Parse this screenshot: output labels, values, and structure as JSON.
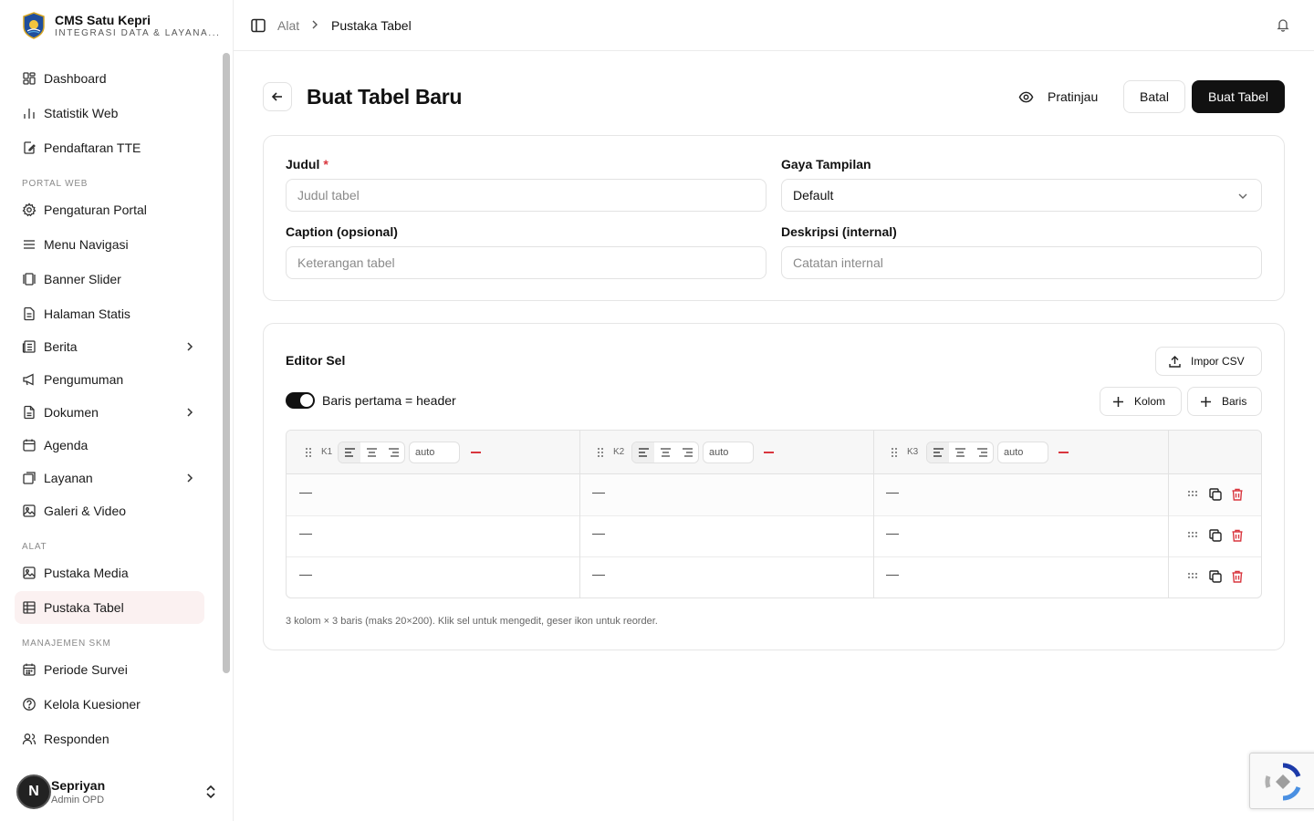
{
  "brand": {
    "title": "CMS Satu Kepri",
    "subtitle": "INTEGRASI DATA & LAYANA..."
  },
  "sidebar": {
    "items_top": [
      {
        "label": "Dashboard",
        "icon": "dashboard-icon"
      },
      {
        "label": "Statistik Web",
        "icon": "bar-chart-icon"
      },
      {
        "label": "Pendaftaran TTE",
        "icon": "signature-icon"
      }
    ],
    "section_portal": "PORTAL WEB",
    "items_portal": [
      {
        "label": "Pengaturan Portal",
        "icon": "gear-icon"
      },
      {
        "label": "Menu Navigasi",
        "icon": "menu-icon"
      },
      {
        "label": "Banner Slider",
        "icon": "slider-icon"
      },
      {
        "label": "Halaman Statis",
        "icon": "file-icon"
      },
      {
        "label": "Berita",
        "icon": "newspaper-icon"
      },
      {
        "label": "Pengumuman",
        "icon": "megaphone-icon"
      },
      {
        "label": "Dokumen",
        "icon": "document-icon"
      },
      {
        "label": "Agenda",
        "icon": "calendar-icon"
      },
      {
        "label": "Layanan",
        "icon": "layers-icon"
      },
      {
        "label": "Galeri & Video",
        "icon": "image-icon"
      }
    ],
    "section_alat": "ALAT",
    "items_alat": [
      {
        "label": "Pustaka Media",
        "icon": "image-icon"
      },
      {
        "label": "Pustaka Tabel",
        "icon": "table-icon",
        "active": true
      }
    ],
    "section_skm": "MANAJEMEN SKM",
    "items_skm": [
      {
        "label": "Periode Survei",
        "icon": "calendar-days-icon"
      },
      {
        "label": "Kelola Kuesioner",
        "icon": "question-circle-icon"
      },
      {
        "label": "Responden",
        "icon": "users-icon"
      }
    ]
  },
  "user": {
    "initial": "N",
    "name": "Sepriyan",
    "role": "Admin OPD"
  },
  "breadcrumb": {
    "parent": "Alat",
    "current": "Pustaka Tabel"
  },
  "header": {
    "title": "Buat Tabel Baru",
    "preview": "Pratinjau",
    "cancel": "Batal",
    "create": "Buat Tabel"
  },
  "form": {
    "title_label": "Judul",
    "title_required": "*",
    "title_placeholder": "Judul tabel",
    "style_label": "Gaya Tampilan",
    "style_value": "Default",
    "caption_label": "Caption (opsional)",
    "caption_placeholder": "Keterangan tabel",
    "desc_label": "Deskripsi (internal)",
    "desc_placeholder": "Catatan internal"
  },
  "editor": {
    "title": "Editor Sel",
    "import_csv": "Impor CSV",
    "header_toggle_label": "Baris pertama = header",
    "header_toggle_on": true,
    "add_column": "Kolom",
    "add_row": "Baris",
    "columns": [
      {
        "key": "K1",
        "width": "auto",
        "align": "left"
      },
      {
        "key": "K2",
        "width": "auto",
        "align": "left"
      },
      {
        "key": "K3",
        "width": "auto",
        "align": "left"
      }
    ],
    "rows": [
      [
        "—",
        "—",
        "—"
      ],
      [
        "—",
        "—",
        "—"
      ],
      [
        "—",
        "—",
        "—"
      ]
    ],
    "footnote": "3 kolom × 3 baris (maks 20×200). Klik sel untuk mengedit, geser ikon untuk reorder."
  }
}
